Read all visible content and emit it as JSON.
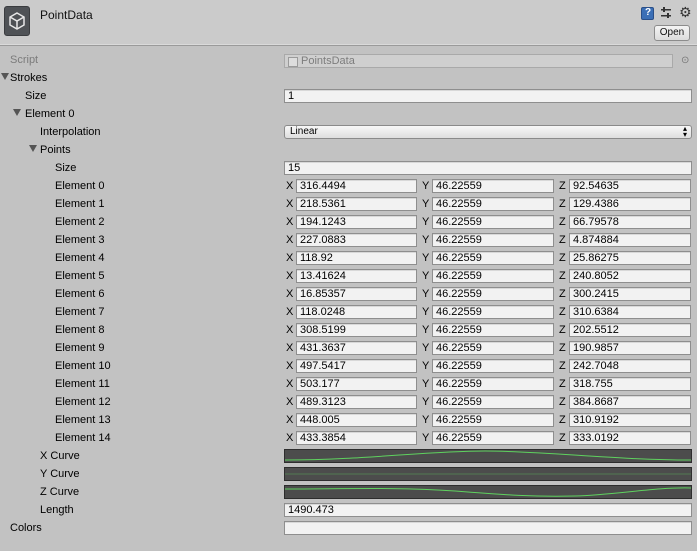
{
  "header": {
    "title": "PointData",
    "open_label": "Open",
    "help_glyph": "?"
  },
  "script": {
    "label": "Script",
    "value": "PointsData"
  },
  "strokes": {
    "label": "Strokes",
    "size_label": "Size",
    "size_value": "1",
    "element0": {
      "label": "Element 0",
      "interpolation_label": "Interpolation",
      "interpolation_value": "Linear",
      "points_label": "Points",
      "points_size_label": "Size",
      "points_size_value": "15",
      "axis_labels": {
        "x": "X",
        "y": "Y",
        "z": "Z"
      },
      "points": [
        {
          "label": "Element 0",
          "x": "316.4494",
          "y": "46.22559",
          "z": "92.54635"
        },
        {
          "label": "Element 1",
          "x": "218.5361",
          "y": "46.22559",
          "z": "129.4386"
        },
        {
          "label": "Element 2",
          "x": "194.1243",
          "y": "46.22559",
          "z": "66.79578"
        },
        {
          "label": "Element 3",
          "x": "227.0883",
          "y": "46.22559",
          "z": "4.874884"
        },
        {
          "label": "Element 4",
          "x": "118.92",
          "y": "46.22559",
          "z": "25.86275"
        },
        {
          "label": "Element 5",
          "x": "13.41624",
          "y": "46.22559",
          "z": "240.8052"
        },
        {
          "label": "Element 6",
          "x": "16.85357",
          "y": "46.22559",
          "z": "300.2415"
        },
        {
          "label": "Element 7",
          "x": "118.0248",
          "y": "46.22559",
          "z": "310.6384"
        },
        {
          "label": "Element 8",
          "x": "308.5199",
          "y": "46.22559",
          "z": "202.5512"
        },
        {
          "label": "Element 9",
          "x": "431.3637",
          "y": "46.22559",
          "z": "190.9857"
        },
        {
          "label": "Element 10",
          "x": "497.5417",
          "y": "46.22559",
          "z": "242.7048"
        },
        {
          "label": "Element 11",
          "x": "503.177",
          "y": "46.22559",
          "z": "318.755"
        },
        {
          "label": "Element 12",
          "x": "489.3123",
          "y": "46.22559",
          "z": "384.8687"
        },
        {
          "label": "Element 13",
          "x": "448.005",
          "y": "46.22559",
          "z": "310.9192"
        },
        {
          "label": "Element 14",
          "x": "433.3854",
          "y": "46.22559",
          "z": "333.0192"
        }
      ],
      "x_curve_label": "X Curve",
      "y_curve_label": "Y Curve",
      "z_curve_label": "Z Curve",
      "length_label": "Length",
      "length_value": "1490.473"
    }
  },
  "colors": {
    "label": "Colors",
    "value": ""
  },
  "theme": {
    "curve_line": "#5fd25f",
    "field_bg": "#f2f2f2",
    "panel_bg": "#c2c2c2"
  }
}
